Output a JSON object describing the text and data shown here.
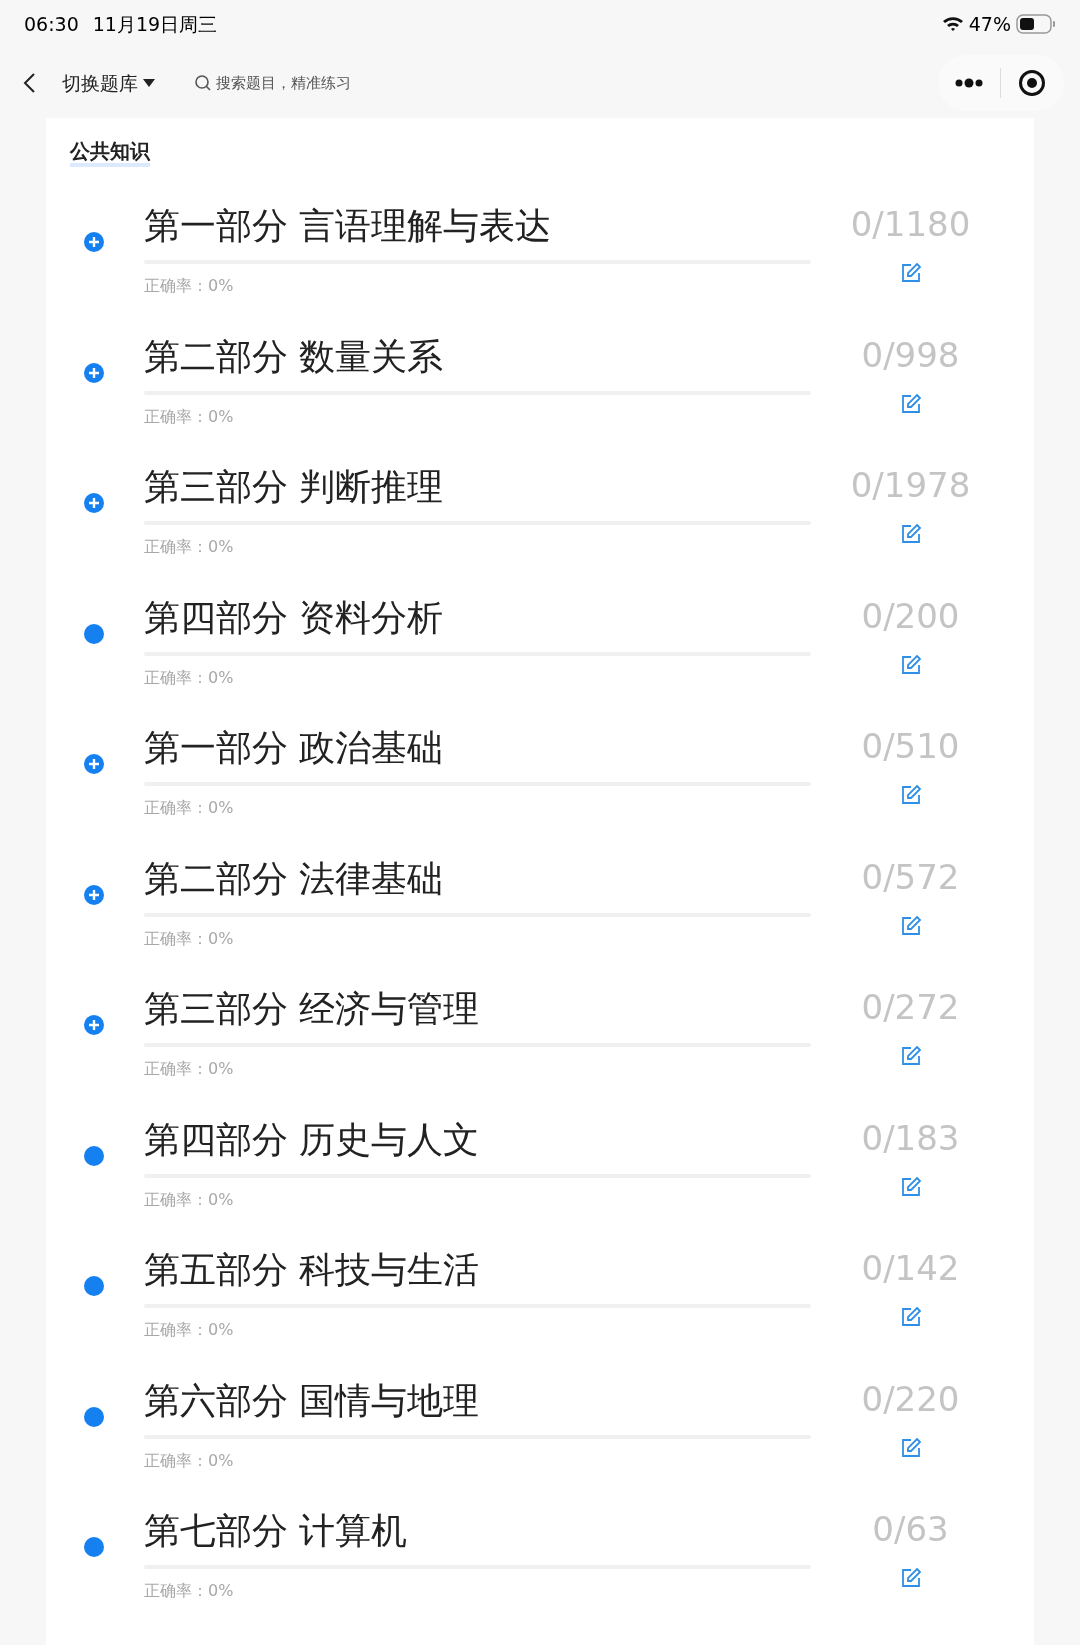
{
  "status_bar": {
    "time": "06:30",
    "date": "11月19日周三",
    "battery": "47%"
  },
  "nav": {
    "title": "切换题库",
    "search": {
      "placeholder": "搜索题目，精准练习"
    }
  },
  "section": {
    "title": "公共知识"
  },
  "items": [
    {
      "kind": "expandable",
      "title": "第一部分 言语理解与表达",
      "count": "0/1180",
      "accuracy": "正确率：0%"
    },
    {
      "kind": "expandable",
      "title": "第二部分 数量关系",
      "count": "0/998",
      "accuracy": "正确率：0%"
    },
    {
      "kind": "expandable",
      "title": "第三部分 判断推理",
      "count": "0/1978",
      "accuracy": "正确率：0%"
    },
    {
      "kind": "leaf",
      "title": "第四部分 资料分析",
      "count": "0/200",
      "accuracy": "正确率：0%"
    },
    {
      "kind": "expandable",
      "title": "第一部分 政治基础",
      "count": "0/510",
      "accuracy": "正确率：0%"
    },
    {
      "kind": "expandable",
      "title": "第二部分 法律基础",
      "count": "0/572",
      "accuracy": "正确率：0%"
    },
    {
      "kind": "expandable",
      "title": "第三部分 经济与管理",
      "count": "0/272",
      "accuracy": "正确率：0%"
    },
    {
      "kind": "leaf",
      "title": "第四部分 历史与人文",
      "count": "0/183",
      "accuracy": "正确率：0%"
    },
    {
      "kind": "leaf",
      "title": "第五部分 科技与生活",
      "count": "0/142",
      "accuracy": "正确率：0%"
    },
    {
      "kind": "leaf",
      "title": "第六部分 国情与地理",
      "count": "0/220",
      "accuracy": "正确率：0%"
    },
    {
      "kind": "leaf",
      "title": "第七部分 计算机",
      "count": "0/63",
      "accuracy": "正确率：0%"
    }
  ]
}
